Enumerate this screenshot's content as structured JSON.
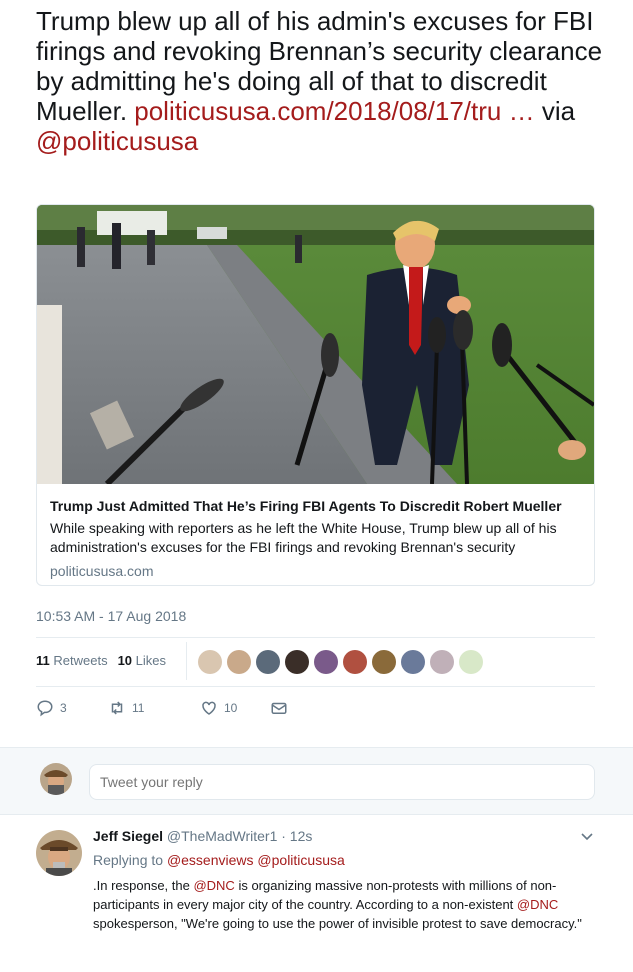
{
  "tweet": {
    "text_part1": "Trump blew up all of his admin's excuses for FBI firings and revoking Brennan’s security clearance by admitting he's doing all of that to discredit Mueller. ",
    "link": "politicususa.com/2018/08/17/tru …",
    "via": " via ",
    "mention": "@politicususa"
  },
  "card": {
    "title": "Trump Just Admitted That He’s Firing FBI Agents To Discredit Robert Mueller",
    "description": "While speaking with reporters as he left the White House, Trump blew up all of his administration's excuses for the FBI firings and revoking Brennan's security",
    "domain": "politicususa.com"
  },
  "timestamp": "10:53 AM - 17 Aug 2018",
  "stats": {
    "retweets_count": "11",
    "retweets_label": "Retweets",
    "likes_count": "10",
    "likes_label": "Likes"
  },
  "actions": {
    "replies": "3",
    "retweets": "11",
    "likes": "10"
  },
  "reply_box": {
    "placeholder": "Tweet your reply"
  },
  "reply": {
    "name": "Jeff Siegel",
    "handle": "@TheMadWriter1 · 12s",
    "replying_to_label": "Replying to ",
    "replying_to_1": "@essenviews",
    "replying_to_2": "@politicususa",
    "text_a": ".In response, the ",
    "mention_dnc_1": "@DNC",
    "text_b": " is organizing massive non-protests with millions of non-participants in every major city of the country. According to a non-existent ",
    "mention_dnc_2": "@DNC",
    "text_c": " spokesperson, \"We're going to use the power of invisible protest to save democracy.\""
  },
  "colors": {
    "link": "#a41c1c",
    "muted": "#657786",
    "text": "#14171a"
  }
}
